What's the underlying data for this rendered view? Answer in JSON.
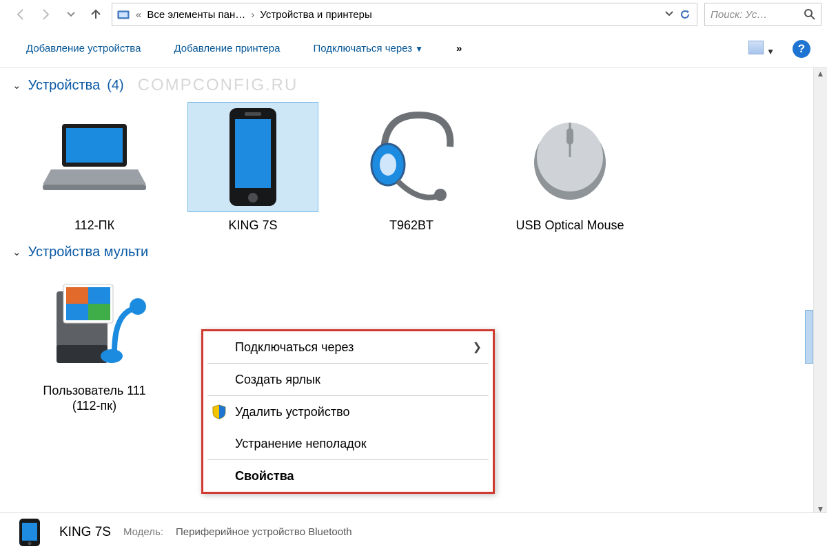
{
  "address": {
    "back_disabled": true,
    "fwd_disabled": true,
    "up_enabled": true,
    "crumb_root": "Все элементы пан…",
    "crumb_current": "Устройства и принтеры"
  },
  "search": {
    "placeholder": "Поиск: Ус…"
  },
  "toolbar": {
    "add_device": "Добавление устройства",
    "add_printer": "Добавление принтера",
    "connect_via": "Подключаться через",
    "more": "»"
  },
  "groups": [
    {
      "title": "Устройства",
      "count": "(4)",
      "watermark": "COMPCONFIG.RU"
    },
    {
      "title": "Устройства мульти"
    }
  ],
  "devices": [
    {
      "id": "pc",
      "label": "112-ПК"
    },
    {
      "id": "phone",
      "label": "KING 7S",
      "selected": true
    },
    {
      "id": "headset",
      "label": "T962BT"
    },
    {
      "id": "mouse",
      "label": "USB Optical Mouse"
    }
  ],
  "media_devices": [
    {
      "id": "mediasrv",
      "label": "Пользователь 111 (112-пк)"
    }
  ],
  "context_menu": [
    {
      "label": "Подключаться через",
      "submenu": true
    },
    {
      "sep": true
    },
    {
      "label": "Создать ярлык"
    },
    {
      "sep": true
    },
    {
      "label": "Удалить устройство",
      "shield": true
    },
    {
      "label": "Устранение неполадок"
    },
    {
      "sep": true
    },
    {
      "label": "Свойства",
      "bold": true
    }
  ],
  "details": {
    "name": "KING 7S",
    "model_label": "Модель:",
    "model_value": "Периферийное устройство Bluetooth"
  }
}
